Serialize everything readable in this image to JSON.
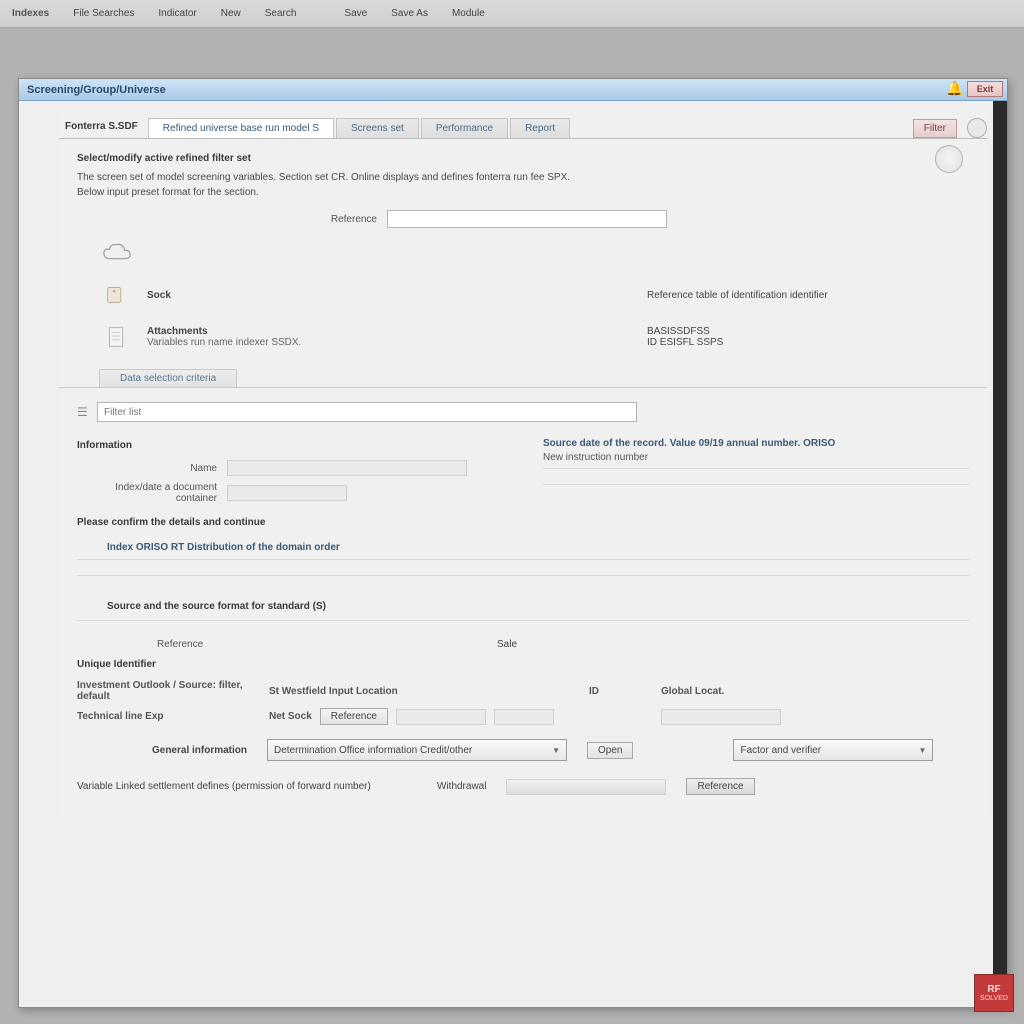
{
  "menubar": {
    "items": [
      "Indexes",
      "File Searches",
      "Indicator",
      "New",
      "Search",
      "",
      "Save",
      "Save As",
      "Module"
    ]
  },
  "window": {
    "title": "Screening/Group/Universe",
    "close": "Exit",
    "ribbon_label": "Fonterra S.SDF",
    "ribbon_tabs": [
      "Refined universe base run model S",
      "Screens set",
      "Performance",
      "Report"
    ],
    "ribbon_action": "Filter",
    "desc": {
      "heading": "Select/modify active refined filter set",
      "body1": "The screen set of model screening variables. Section set CR. Online displays and defines fonterra run fee SPX.",
      "body2": "Below input preset format for the section."
    },
    "field_generic_label": "Reference",
    "field_generic_value": "",
    "iconrows": [
      {
        "title": "",
        "sub": ""
      },
      {
        "title": "Sock",
        "sub": ""
      },
      {
        "title": "Attachments",
        "sub": "Variables run name indexer SSDX."
      },
      {
        "title": "Reference table of identification identifier",
        "sub": ""
      }
    ],
    "rightlabels": [
      "",
      "Reference table of identification identifier",
      "BASISSDFSS\nID ESISFL SSPS"
    ],
    "tabstrip": [
      "Data selection criteria"
    ],
    "search_placeholder": "Filter list",
    "section1": "Information",
    "row_name_lbl": "Name",
    "row_index_lbl": "Index/date a document container",
    "row_index_val": "",
    "note_right": "Source date of the record. Value 09/19 annual number. ORISO",
    "note_right2": "New instruction number",
    "section2": "Please confirm the details and continue",
    "section3": "Index ORISO RT Distribution of the domain order",
    "section4": "Source and the source format for standard (S)",
    "col_a": "Reference",
    "col_b": "Sale",
    "section5": "Unique Identifier",
    "grid": {
      "r1a": "Investment Outlook / Source: filter, default",
      "r1b": "St Westfield Input Location",
      "r1c": "ID",
      "r1d": "Global Locat.",
      "r2a": "Technical line Exp",
      "r2b": "Net Sock",
      "r2b2": "Reference"
    },
    "dropdown1_lbl": "General information",
    "dropdown1_val": "Determination Office information Credit/other",
    "dropdown1_btn": "Open",
    "dropdown2_val": "Factor and verifier",
    "footer_label": "Variable Linked settlement defines (permission of forward number)",
    "footer_field_lbl": "Withdrawal",
    "footer_btn": "Reference"
  },
  "stamp": {
    "top": "RF",
    "bottom": "SOLVED"
  }
}
